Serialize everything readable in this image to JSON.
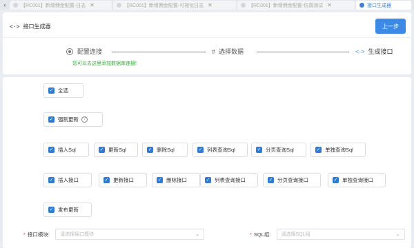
{
  "tabs": [
    {
      "label": "【RC001】新增佣金配置-日志"
    },
    {
      "label": "【RC001】新增佣金配置-可视化日志"
    },
    {
      "label": "【RC001】新增佣金配置-仿真测试"
    },
    {
      "label": "接口生成器"
    }
  ],
  "header": {
    "title": "接口生成器",
    "prev_label": "上一步"
  },
  "steps": [
    {
      "label": "配置连接"
    },
    {
      "label": "选择数据"
    },
    {
      "label": "生成接口"
    }
  ],
  "db_link": "您可以去这里添加数据库连接!",
  "options": {
    "select_all": "全选",
    "force_update": "强制更新",
    "sql": [
      "插入Sql",
      "更新Sql",
      "删除Sql",
      "列表查询Sql",
      "分页查询Sql",
      "单独查询Sql"
    ],
    "api": [
      "插入接口",
      "更新接口",
      "删除接口",
      "列表查询接口",
      "分页查询接口",
      "单独查询接口"
    ],
    "publish": "发布更新"
  },
  "form": {
    "module_label": "接口模块:",
    "module_placeholder": "请选择接口模块",
    "sql_group_label": "SQL组:",
    "sql_group_placeholder": "请选择SQL组"
  },
  "colors": {
    "accent": "#3d8ae6",
    "link": "#3aa83a",
    "checkbox": "#2e7bd6"
  }
}
